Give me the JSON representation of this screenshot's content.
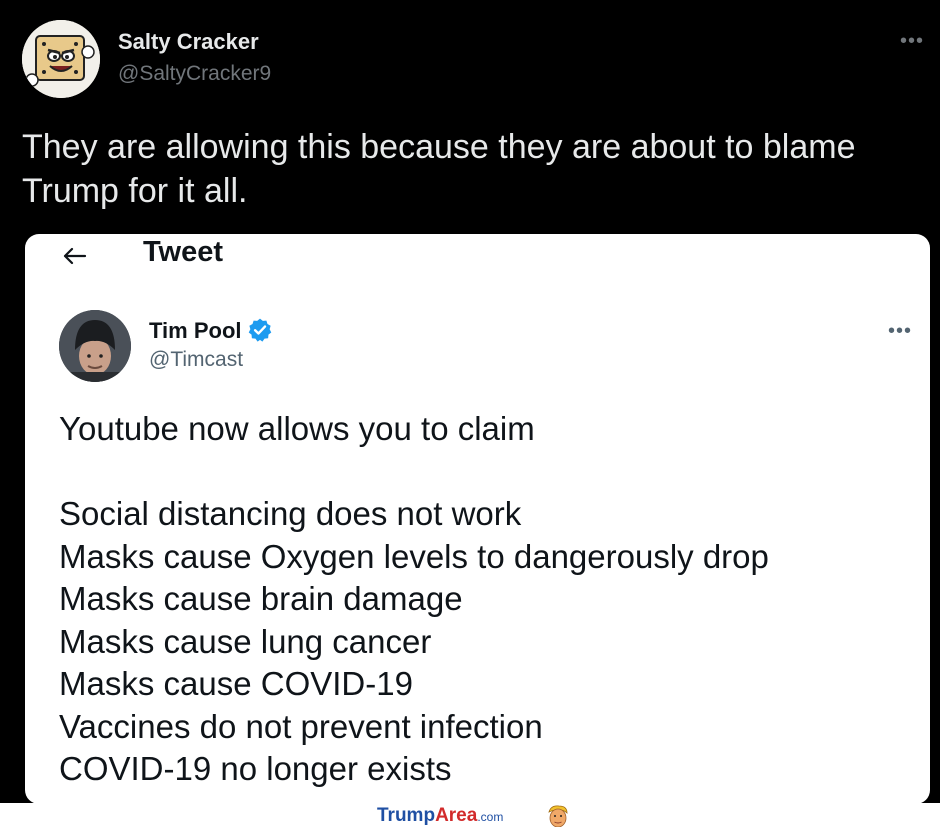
{
  "outer_tweet": {
    "name": "Salty Cracker",
    "handle": "@SaltyCracker9",
    "text": "They are allowing this because they are about to blame Trump for it all.",
    "more": "•••",
    "avatar_icon": "cracker-mascot-avatar"
  },
  "embedded_tweet": {
    "header_title": "Tweet",
    "back_icon": "arrow-left-icon",
    "name": "Tim Pool",
    "verified_icon": "verified-badge-icon",
    "handle": "@Timcast",
    "more": "•••",
    "intro": "Youtube now allows you to claim",
    "claims": [
      "Social distancing does not work",
      "Masks cause Oxygen levels to dangerously drop",
      "Masks cause brain damage",
      "Masks cause lung cancer",
      "Masks cause COVID-19",
      "Vaccines do not prevent infection",
      "COVID-19 no longer exists"
    ]
  },
  "watermark": {
    "part1": "Trump",
    "part2": "Area",
    "part3": ".com",
    "logo_icon": "trump-face-logo"
  },
  "colors": {
    "background_dark": "#000000",
    "text_light": "#e7e9ea",
    "muted": "#71767b",
    "verified_blue": "#1d9bf0"
  }
}
